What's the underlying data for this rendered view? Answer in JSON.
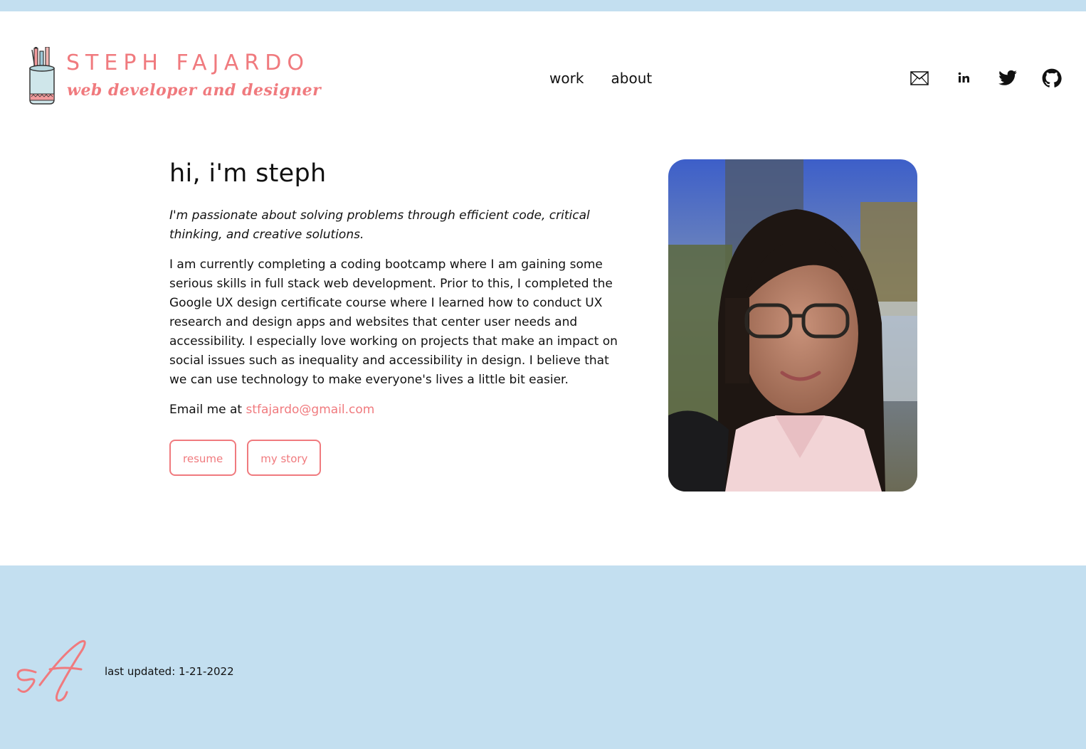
{
  "brand": {
    "name": "STEPH FAJARDO",
    "tagline": "web developer and designer",
    "accent_color": "#f07a7e",
    "band_color": "#c3dff0"
  },
  "nav": {
    "items": [
      {
        "label": "work"
      },
      {
        "label": "about"
      }
    ]
  },
  "social": [
    {
      "icon": "mail-icon"
    },
    {
      "icon": "linkedin-icon"
    },
    {
      "icon": "twitter-icon"
    },
    {
      "icon": "github-icon"
    }
  ],
  "intro": {
    "heading": "hi, i'm steph",
    "tagline": "I'm passionate about solving problems through efficient code, critical thinking, and creative solutions.",
    "bio": "I am currently completing a coding bootcamp where I am gaining some serious skills in full stack web development. Prior to this, I completed the Google UX design certificate course where I learned how to conduct UX research and design apps and websites that center user needs and accessibility. I especially love working on projects that make an impact on social issues such as inequality and accessibility in design. I believe that we can use technology to make everyone's lives a little bit easier.",
    "email_prefix": "Email me at",
    "email": "stfajardo@gmail.com",
    "buttons": {
      "resume": "resume",
      "story": "my story"
    }
  },
  "footer": {
    "updated": "last updated: 1-21-2022"
  }
}
